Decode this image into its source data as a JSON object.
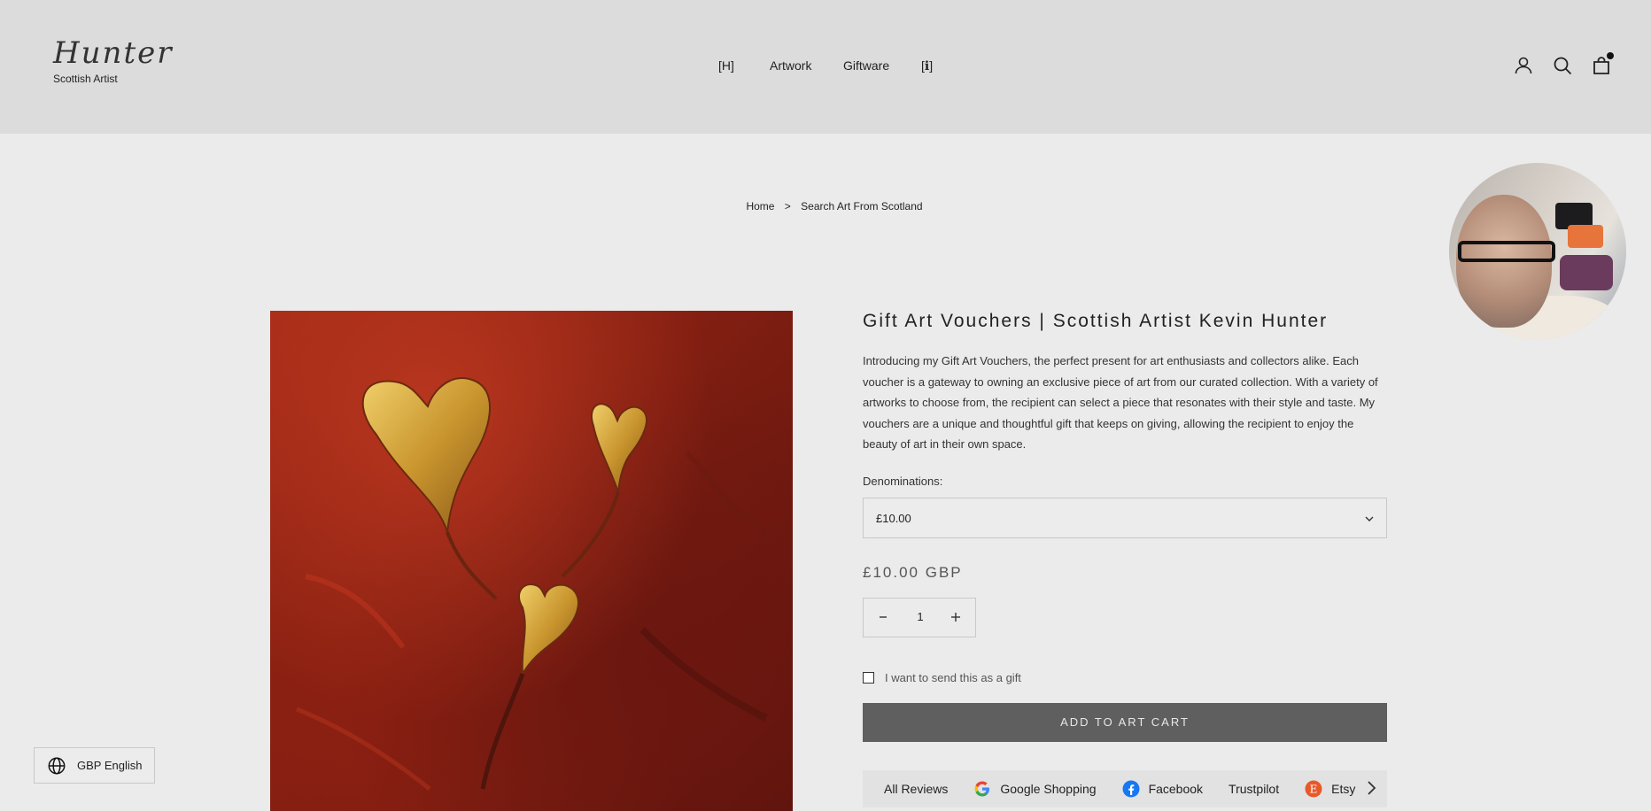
{
  "header": {
    "logo_script": "Hunter",
    "logo_subtitle": "Scottish Artist",
    "nav": [
      {
        "label": "[H]"
      },
      {
        "label": "Artwork"
      },
      {
        "label": "Giftware"
      },
      {
        "label": "[ℹ]"
      }
    ],
    "icons": [
      "account-icon",
      "search-icon",
      "cart-icon"
    ]
  },
  "breadcrumb": {
    "home": "Home",
    "separator": ">",
    "current": "Search Art From Scotland"
  },
  "product": {
    "title": "Gift Art Vouchers | Scottish Artist Kevin Hunter",
    "description": "Introducing my Gift Art Vouchers, the perfect present for art enthusiasts and collectors alike. Each voucher is a gateway to owning an exclusive piece of art from our curated collection. With a variety of artworks to choose from, the recipient can select a piece that resonates with their style and taste. My vouchers are a unique and thoughtful gift that keeps on giving, allowing the recipient to enjoy the beauty of art in their own space.",
    "denomination_label": "Denominations:",
    "denomination_selected": "£10.00",
    "price": "£10.00 GBP",
    "quantity": "1",
    "gift_label": "I want to send this as a gift",
    "gift_checked": false,
    "add_to_cart": "ADD TO ART CART"
  },
  "reviews": {
    "items": [
      {
        "label": "All Reviews",
        "icon": ""
      },
      {
        "label": "Google Shopping",
        "icon": "google-icon"
      },
      {
        "label": "Facebook",
        "icon": "facebook-icon"
      },
      {
        "label": "Trustpilot",
        "icon": ""
      },
      {
        "label": "Etsy",
        "icon": "etsy-icon"
      }
    ]
  },
  "locale": {
    "label": "GBP English"
  },
  "colors": {
    "header_bg": "#dcdcdc",
    "page_bg": "#ebebeb",
    "button_bg": "#5f5f5f",
    "painting_red": "#a42a17",
    "painting_gold": "#d4a53a"
  }
}
